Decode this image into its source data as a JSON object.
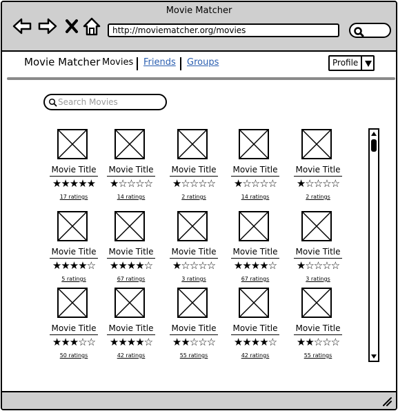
{
  "window": {
    "title": "Movie Matcher"
  },
  "browser": {
    "url": "http://moviematcher.org/movies",
    "icons": [
      "back-arrow-icon",
      "forward-arrow-icon",
      "close-x-icon",
      "home-icon",
      "search-icon"
    ]
  },
  "header": {
    "brand": "Movie Matcher",
    "nav": [
      {
        "label": "Movies",
        "active": true
      },
      {
        "label": "Friends",
        "active": false
      },
      {
        "label": "Groups",
        "active": false
      }
    ],
    "profile": {
      "label": "Profile",
      "icon": "caret-down-icon"
    }
  },
  "search": {
    "placeholder": "Search Movies",
    "value": ""
  },
  "movies": [
    {
      "title": "Movie Title",
      "stars": 5,
      "ratings": "17 ratings"
    },
    {
      "title": "Movie Title",
      "stars": 1,
      "ratings": "14 ratings"
    },
    {
      "title": "Movie Title",
      "stars": 1,
      "ratings": "2 ratings"
    },
    {
      "title": "Movie Title",
      "stars": 1,
      "ratings": "14 ratings"
    },
    {
      "title": "Movie Title",
      "stars": 1,
      "ratings": "2 ratings"
    },
    {
      "title": "Movie Title",
      "stars": 4,
      "ratings": "5 ratings"
    },
    {
      "title": "Movie Title",
      "stars": 4,
      "ratings": "67 ratings"
    },
    {
      "title": "Movie Title",
      "stars": 1,
      "ratings": "3 ratings"
    },
    {
      "title": "Movie Title",
      "stars": 4,
      "ratings": "67 ratings"
    },
    {
      "title": "Movie Title",
      "stars": 1,
      "ratings": "3 ratings"
    },
    {
      "title": "Movie Title",
      "stars": 3,
      "ratings": "50 ratings"
    },
    {
      "title": "Movie Title",
      "stars": 4,
      "ratings": "42 ratings"
    },
    {
      "title": "Movie Title",
      "stars": 2,
      "ratings": "55 ratings"
    },
    {
      "title": "Movie Title",
      "stars": 4,
      "ratings": "42 ratings"
    },
    {
      "title": "Movie Title",
      "stars": 2,
      "ratings": "55 ratings"
    }
  ],
  "rating_scale": 5,
  "scrollbar": {
    "position": 0
  }
}
